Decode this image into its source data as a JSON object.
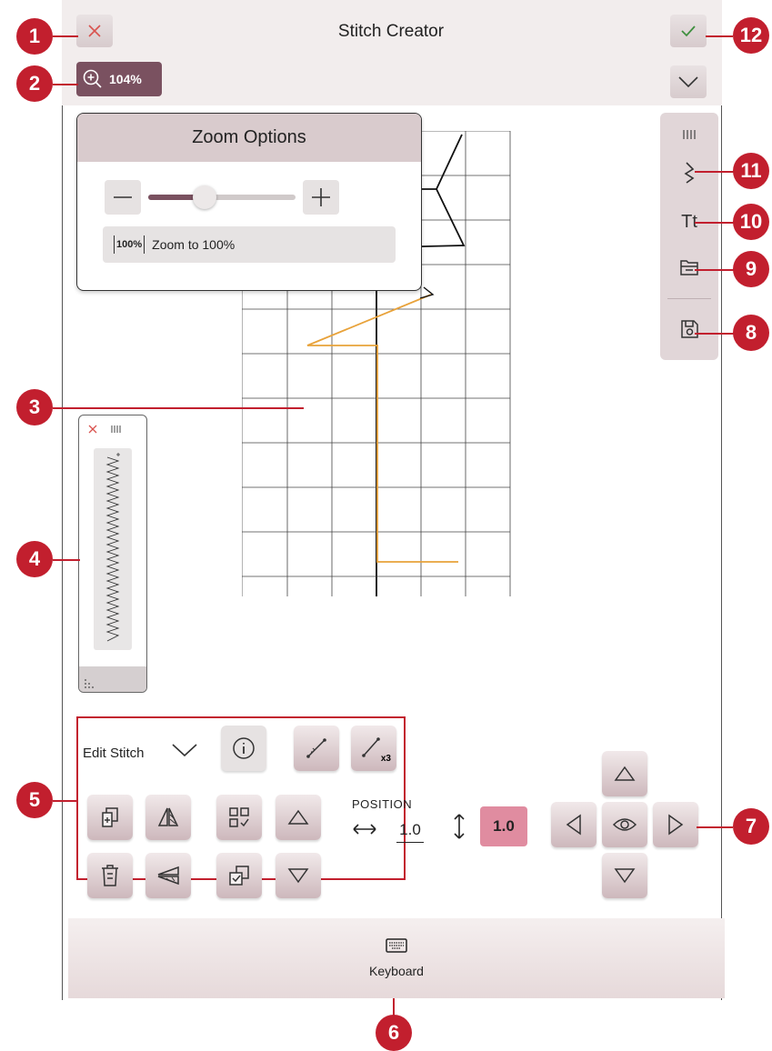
{
  "header": {
    "title": "Stitch Creator",
    "zoom_label": "104%"
  },
  "zoom_panel": {
    "title": "Zoom Options",
    "zoom_to_100_label": "Zoom to 100%",
    "zoom_to_100_icon_text": "100%",
    "slider_level": 0.38
  },
  "edit": {
    "mode_label": "Edit Stitch",
    "multiplier_label": "x3"
  },
  "position": {
    "label": "POSITION",
    "horizontal_value": "1.0",
    "vertical_value": "1.0"
  },
  "keyboard": {
    "label": "Keyboard"
  },
  "sidebar": {
    "text_tool_label": "Tt"
  },
  "callouts": [
    "1",
    "2",
    "3",
    "4",
    "5",
    "6",
    "7",
    "8",
    "9",
    "10",
    "11",
    "12"
  ],
  "colors": {
    "accent": "#c21f2e",
    "stitch_line": "#e8a23a",
    "zoom_button": "#7a5160",
    "highlight_value": "#e08ca0"
  }
}
